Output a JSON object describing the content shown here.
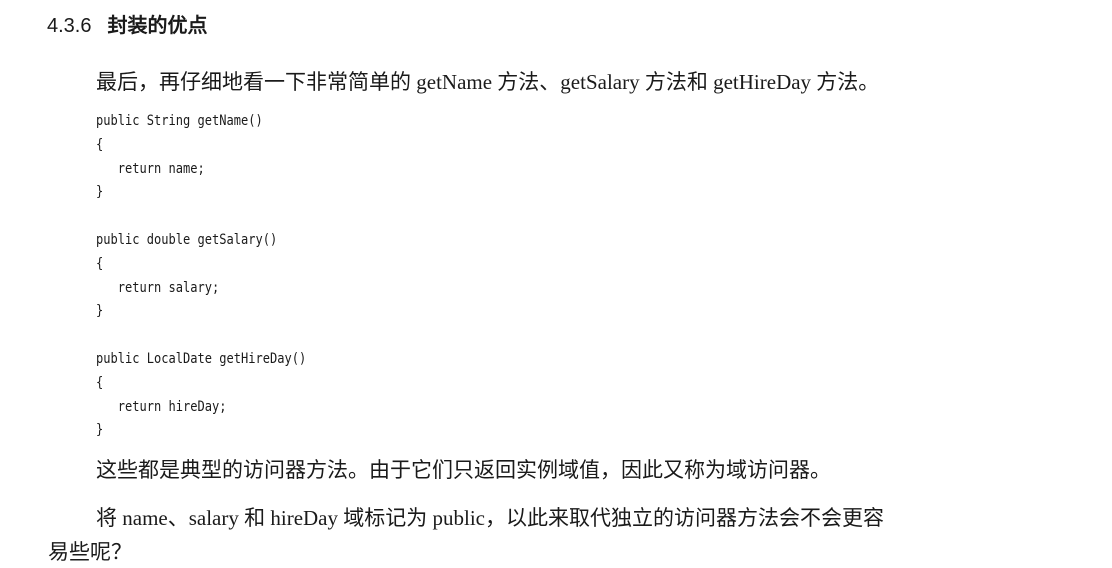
{
  "section": {
    "number": "4.3.6",
    "title": "封装的优点"
  },
  "paragraphs": {
    "intro": "最后，再仔细地看一下非常简单的 getName 方法、getSalary 方法和 getHireDay 方法。",
    "accessors": "这些都是典型的访问器方法。由于它们只返回实例域值，因此又称为域访问器。",
    "question_line1": "将 name、salary 和 hireDay 域标记为 public，以此来取代独立的访问器方法会不会更容",
    "question_line2": "易些呢？"
  },
  "code": {
    "lines": [
      "public String getName()",
      "{",
      "   return name;",
      "}",
      "",
      "public double getSalary()",
      "{",
      "   return salary;",
      "}",
      "",
      "public LocalDate getHireDay()",
      "{",
      "   return hireDay;",
      "}"
    ]
  }
}
